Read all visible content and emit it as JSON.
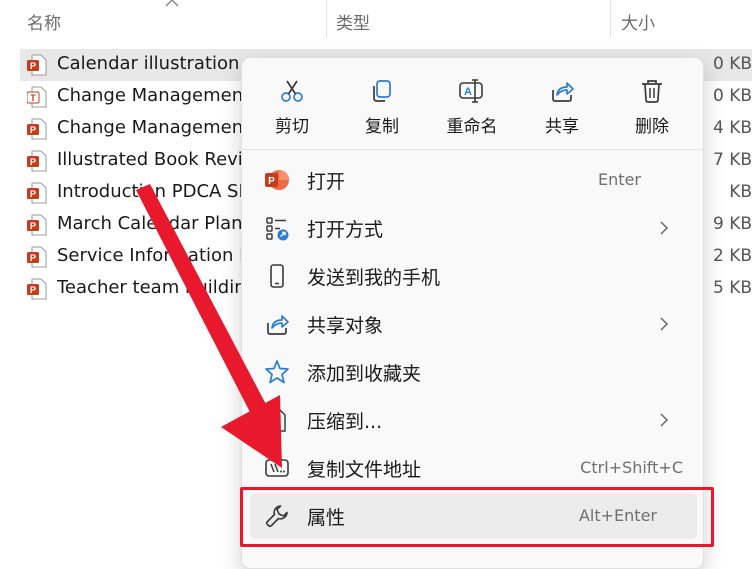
{
  "header": {
    "name_col": "名称",
    "type_col": "类型",
    "size_col": "大小"
  },
  "files": [
    {
      "name": "Calendar illustration.p",
      "size": "0 KB",
      "selected": true,
      "icon": "pptx-file-icon"
    },
    {
      "name": "Change Management",
      "size": "0 KB",
      "selected": false,
      "icon": "ppt-template-file-icon"
    },
    {
      "name": "Change Management",
      "size": "4 KB",
      "selected": false,
      "icon": "pptx-file-icon"
    },
    {
      "name": "Illustrated Book Revie",
      "size": "7 KB",
      "selected": false,
      "icon": "pptx-file-icon"
    },
    {
      "name": "Introduction PDCA SI",
      "size": "KB",
      "selected": false,
      "icon": "pptx-file-icon"
    },
    {
      "name": "March Calendar Plann",
      "size": "9 KB",
      "selected": false,
      "icon": "pptx-file-icon"
    },
    {
      "name": "Service Information M",
      "size": "2 KB",
      "selected": false,
      "icon": "pptx-file-icon"
    },
    {
      "name": "Teacher team buildin",
      "size": "5 KB",
      "selected": false,
      "icon": "pptx-file-icon"
    }
  ],
  "quick_actions": [
    {
      "label": "剪切",
      "icon": "scissors-icon"
    },
    {
      "label": "复制",
      "icon": "copy-icon"
    },
    {
      "label": "重命名",
      "icon": "rename-icon"
    },
    {
      "label": "共享",
      "icon": "share-icon"
    },
    {
      "label": "删除",
      "icon": "trash-icon"
    }
  ],
  "menu_items": [
    {
      "label": "打开",
      "shortcut": "Enter",
      "icon": "powerpoint-icon"
    },
    {
      "label": "打开方式",
      "shortcut": "",
      "icon": "open-with-icon",
      "submenu": true
    },
    {
      "label": "发送到我的手机",
      "shortcut": "",
      "icon": "phone-icon"
    },
    {
      "label": "共享对象",
      "shortcut": "",
      "icon": "share-to-icon",
      "submenu": true
    },
    {
      "label": "添加到收藏夹",
      "shortcut": "",
      "icon": "star-icon"
    },
    {
      "label": "压缩到...",
      "shortcut": "",
      "icon": "zip-icon",
      "submenu": true
    },
    {
      "label": "复制文件地址",
      "shortcut": "Ctrl+Shift+C",
      "icon": "copy-path-icon"
    },
    {
      "label": "属性",
      "shortcut": "Alt+Enter",
      "icon": "wrench-icon",
      "highlighted": true
    }
  ],
  "colors": {
    "accent_blue": "#2b7cd3",
    "ppt_orange": "#c43e1c",
    "annotation_red": "#e8192c"
  }
}
